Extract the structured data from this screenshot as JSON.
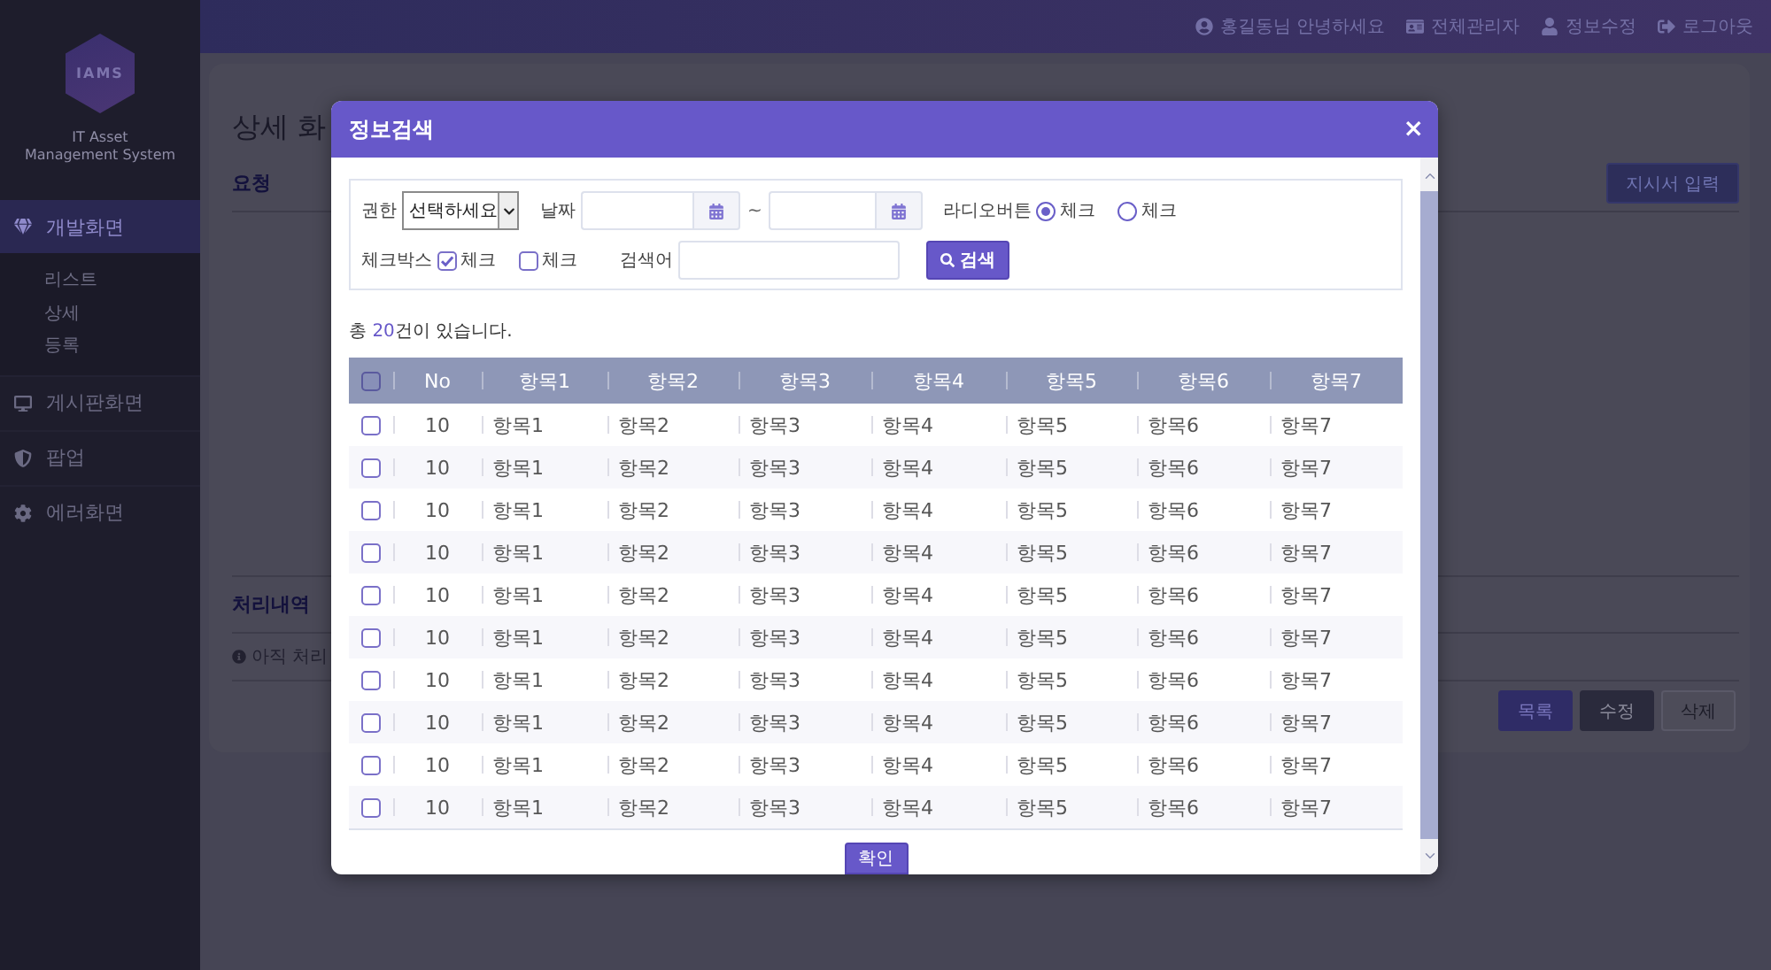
{
  "sidebar": {
    "logo": {
      "text": "IAMS",
      "caption": [
        "IT Asset",
        "Management System"
      ]
    },
    "menu": [
      {
        "kind": "diamond",
        "label": "개발화면",
        "selected": true,
        "children": [
          {
            "label": "리스트"
          },
          {
            "label": "상세"
          },
          {
            "label": "등록"
          }
        ]
      },
      {
        "kind": "monitor",
        "label": "게시판화면",
        "selected": false
      },
      {
        "kind": "shield",
        "label": "팝업",
        "selected": false
      },
      {
        "kind": "gear",
        "label": "에러화면",
        "selected": false
      }
    ]
  },
  "top_bar": {
    "links": [
      {
        "kind": "user",
        "label": "홍길동님 안녕하세요"
      },
      {
        "kind": "admin",
        "label": "전체관리자"
      },
      {
        "kind": "profile",
        "label": "정보수정"
      },
      {
        "kind": "logout",
        "label": "로그아웃"
      }
    ]
  },
  "page": {
    "title": "상세 화",
    "section": "요청",
    "action_button": "지시서 입력",
    "history": {
      "title": "처리내역",
      "notice": "아직 처리"
    },
    "buttons": [
      {
        "kind": "primary",
        "label": "목록"
      },
      {
        "kind": "dark",
        "label": "수정"
      },
      {
        "kind": "plain",
        "label": "삭제"
      }
    ]
  },
  "modal": {
    "title": "정보검색",
    "close": "×",
    "filters": {
      "role": {
        "label": "권한",
        "value": "선택하세요"
      },
      "date": {
        "label": "날짜",
        "separator": "~"
      },
      "radio": {
        "label": "라디오버튼",
        "options": [
          {
            "label": "체크",
            "selected": true
          },
          {
            "label": "체크",
            "selected": false
          }
        ]
      },
      "checkbox": {
        "label": "체크박스",
        "options": [
          {
            "label": "체크",
            "checked": true
          },
          {
            "label": "체크",
            "checked": false
          }
        ]
      },
      "keyword": {
        "label": "검색어"
      },
      "search_button": "검색"
    },
    "result": {
      "prefix": "총 ",
      "count": "20",
      "suffix": "건이 있습니다."
    },
    "table": {
      "select_all": {
        "checked": false
      },
      "columns": [
        "No",
        "항목1",
        "항목2",
        "항목3",
        "항목4",
        "항목5",
        "항목6",
        "항목7"
      ],
      "rows": [
        {
          "checked": false,
          "cells": [
            "10",
            "항목1",
            "항목2",
            "항목3",
            "항목4",
            "항목5",
            "항목6",
            "항목7"
          ]
        },
        {
          "checked": false,
          "cells": [
            "10",
            "항목1",
            "항목2",
            "항목3",
            "항목4",
            "항목5",
            "항목6",
            "항목7"
          ]
        },
        {
          "checked": false,
          "cells": [
            "10",
            "항목1",
            "항목2",
            "항목3",
            "항목4",
            "항목5",
            "항목6",
            "항목7"
          ]
        },
        {
          "checked": false,
          "cells": [
            "10",
            "항목1",
            "항목2",
            "항목3",
            "항목4",
            "항목5",
            "항목6",
            "항목7"
          ]
        },
        {
          "checked": false,
          "cells": [
            "10",
            "항목1",
            "항목2",
            "항목3",
            "항목4",
            "항목5",
            "항목6",
            "항목7"
          ]
        },
        {
          "checked": false,
          "cells": [
            "10",
            "항목1",
            "항목2",
            "항목3",
            "항목4",
            "항목5",
            "항목6",
            "항목7"
          ]
        },
        {
          "checked": false,
          "cells": [
            "10",
            "항목1",
            "항목2",
            "항목3",
            "항목4",
            "항목5",
            "항목6",
            "항목7"
          ]
        },
        {
          "checked": false,
          "cells": [
            "10",
            "항목1",
            "항목2",
            "항목3",
            "항목4",
            "항목5",
            "항목6",
            "항목7"
          ]
        },
        {
          "checked": false,
          "cells": [
            "10",
            "항목1",
            "항목2",
            "항목3",
            "항목4",
            "항목5",
            "항목6",
            "항목7"
          ]
        },
        {
          "checked": false,
          "cells": [
            "10",
            "항목1",
            "항목2",
            "항목3",
            "항목4",
            "항목5",
            "항목6",
            "항목7"
          ]
        }
      ]
    },
    "confirm": "확인"
  }
}
